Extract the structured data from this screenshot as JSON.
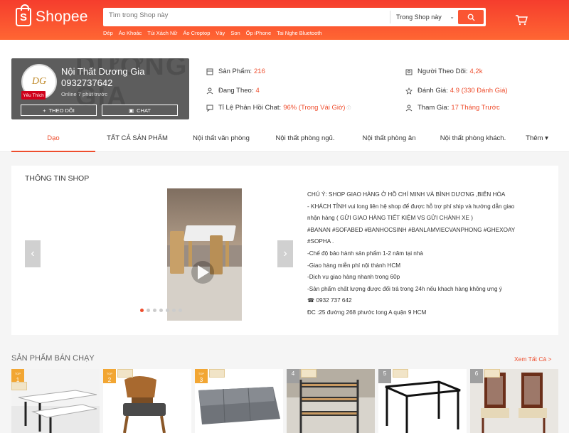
{
  "header": {
    "logo_text": "Shopee",
    "search_placeholder": "Tìm trong Shop này",
    "search_scope": "Trong Shop này",
    "hotwords": [
      "Dép",
      "Áo Khoác",
      "Túi Xách Nữ",
      "Áo Croptop",
      "Váy",
      "Son",
      "Ốp iPhone",
      "Tai Nghe Bluetooth"
    ]
  },
  "shop": {
    "name": "Nội Thất Dương Gia",
    "phone": "0932737642",
    "online": "Online 7 phút trước",
    "avatar_initials": "DG",
    "badge": "Yêu Thích",
    "follow_label": "THEO DÕI",
    "chat_label": "CHAT",
    "stats": {
      "products_label": "Sản Phẩm:",
      "products_value": "216",
      "following_label": "Đang Theo:",
      "following_value": "4",
      "response_label": "Tỉ Lệ Phản Hồi Chat:",
      "response_value": "96% (Trong Vài Giờ)",
      "followers_label": "Người Theo Dõi:",
      "followers_value": "4,2k",
      "rating_label": "Đánh Giá:",
      "rating_value": "4.9 (330 Đánh Giá)",
      "joined_label": "Tham Gia:",
      "joined_value": "17 Tháng Trước"
    }
  },
  "tabs": [
    "Dạo",
    "TẤT CẢ SẢN PHẨM",
    "Nội thất văn phòng",
    "Nội thất phòng ngủ.",
    "Nội thất phòng ăn",
    "Nội thất phòng khách.",
    "Thêm"
  ],
  "info": {
    "title": "THÔNG TIN SHOP",
    "description": [
      "CHÚ Ý: SHOP GIAO HÀNG Ở HỒ CHÍ MINH VÀ BÌNH DƯƠNG ,BIÊN HÒA",
      "- KHÁCH TỈNH vui long liên hệ shop để được hỗ trợ phí ship và hướng dẫn giao",
      "nhận hàng ( GỬI GIAO HÀNG TIẾT KIỆM VS GỬI CHÀNH XE )",
      " #BANAN #SOFABED #BANHOCSINH #BANLAMVIECVANPHONG #GHEXOAY",
      "#SOPHA .",
      "-Chế độ bảo hành sản phẩm 1-2 năm tại nhà",
      "-Giao hàng miễn phí nội thành HCM",
      "-Dịch vụ giao hàng nhanh trong 60p",
      "-Sản phẩm chất lượng được đổi trả trong 24h nếu khach hàng không ưng ý",
      "☎ 0932 737 642",
      "ĐC :25 đường 268 phước long A quận 9 HCM"
    ]
  },
  "best_sellers": {
    "title": "SẢN PHẨM BÁN CHẠY",
    "see_all": "Xem Tất Cả >",
    "ranks": [
      "1",
      "2",
      "3",
      "4",
      "5",
      "6"
    ],
    "top_label": "TOP"
  },
  "colors": {
    "brand": "#ee4d2d",
    "header_gradient_start": "#f53d2d",
    "header_gradient_end": "#ff6633"
  }
}
